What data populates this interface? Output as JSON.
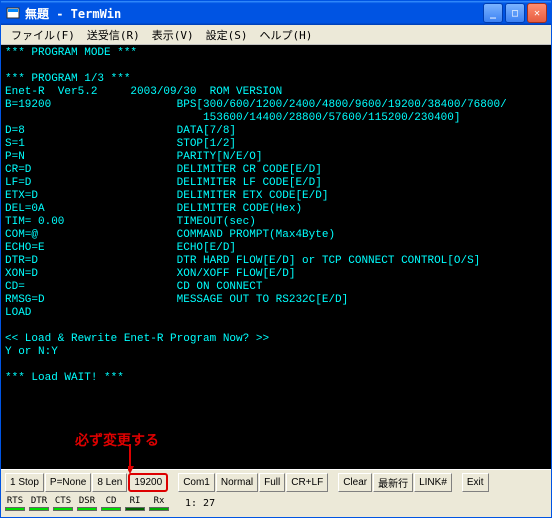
{
  "titlebar": {
    "title": "無題 - TermWin"
  },
  "menubar": {
    "file": "ファイル(F)",
    "sendrecv": "送受信(R)",
    "display": "表示(V)",
    "settings": "設定(S)",
    "help": "ヘルプ(H)"
  },
  "terminal_lines": [
    "*** PROGRAM MODE ***",
    "",
    "*** PROGRAM 1/3 ***",
    "Enet-R  Ver5.2     2003/09/30  ROM VERSION",
    "B=19200                   BPS[300/600/1200/2400/4800/9600/19200/38400/76800/",
    "                              153600/14400/28800/57600/115200/230400]",
    "D=8                       DATA[7/8]",
    "S=1                       STOP[1/2]",
    "P=N                       PARITY[N/E/O]",
    "CR=D                      DELIMITER CR CODE[E/D]",
    "LF=D                      DELIMITER LF CODE[E/D]",
    "ETX=D                     DELIMITER ETX CODE[E/D]",
    "DEL=0A                    DELIMITER CODE(Hex)",
    "TIM= 0.00                 TIMEOUT(sec)",
    "COM=@                     COMMAND PROMPT(Max4Byte)",
    "ECHO=E                    ECHO[E/D]",
    "DTR=D                     DTR HARD FLOW[E/D] or TCP CONNECT CONTROL[O/S]",
    "XON=D                     XON/XOFF FLOW[E/D]",
    "CD=                       CD ON CONNECT",
    "RMSG=D                    MESSAGE OUT TO RS232C[E/D]",
    "LOAD",
    "",
    "<< Load & Rewrite Enet-R Program Now? >>",
    "Y or N:Y",
    "",
    "*** Load WAIT! ***"
  ],
  "annotation": {
    "text": "必ず変更する"
  },
  "statusbar": {
    "stop": "1 Stop",
    "parity": "P=None",
    "len": "8 Len",
    "baud": "19200",
    "com": "Com1",
    "mode": "Normal",
    "full": "Full",
    "crlf": "CR+LF",
    "clear": "Clear",
    "latest": "最新行",
    "link": "LINK#",
    "exit": "Exit"
  },
  "indicators": {
    "rts": "RTS",
    "dtr": "DTR",
    "cts": "CTS",
    "dsr": "DSR",
    "cd": "CD",
    "ri": "RI",
    "rx": "Rx"
  },
  "position": "1: 27"
}
